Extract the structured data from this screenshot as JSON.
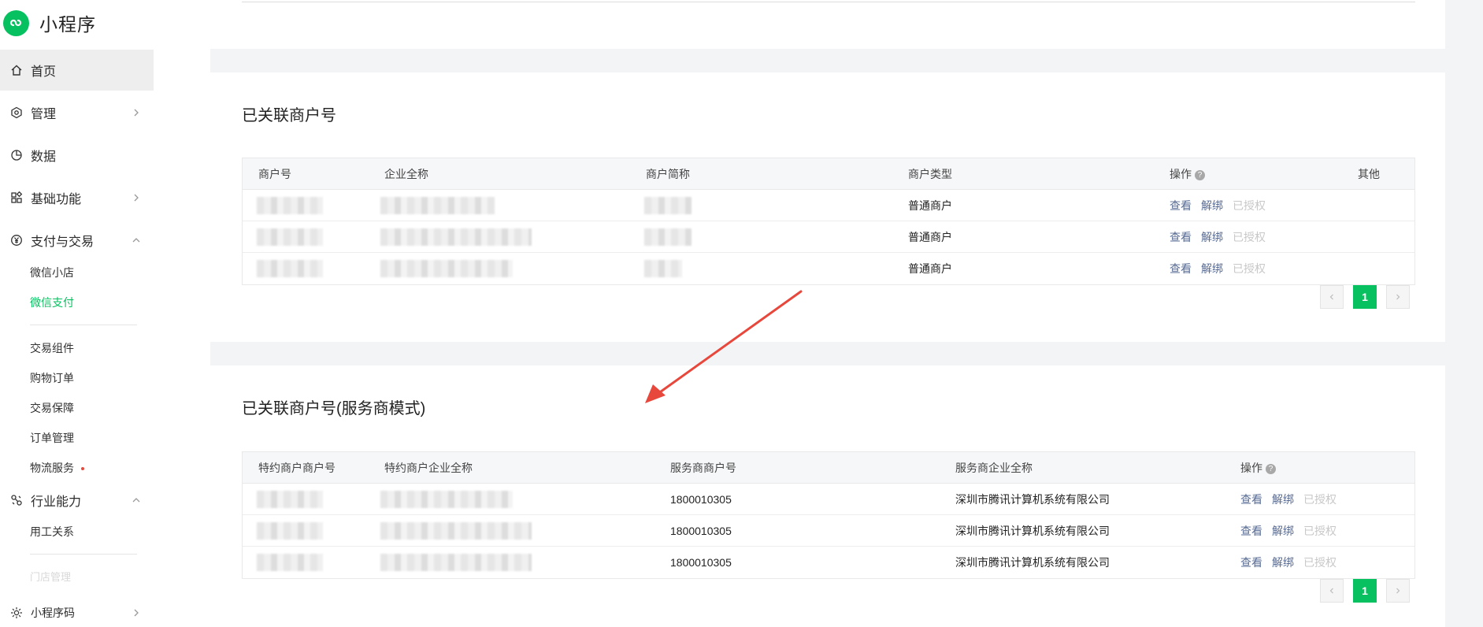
{
  "brand": {
    "name": "小程序",
    "logo_icon": "mini-program-logo-icon",
    "accent": "#07c160"
  },
  "sidebar": {
    "items": [
      {
        "label": "首页",
        "icon": "home-icon",
        "active": true
      },
      {
        "label": "管理",
        "icon": "manage-icon",
        "chevron": "right"
      },
      {
        "label": "数据",
        "icon": "data-pie-icon"
      },
      {
        "label": "基础功能",
        "icon": "grid-icon",
        "chevron": "right"
      },
      {
        "label": "支付与交易",
        "icon": "yen-icon",
        "chevron": "up"
      }
    ],
    "payment_sub": [
      "微信小店",
      "微信支付"
    ],
    "trade_sub": [
      "交易组件",
      "购物订单",
      "交易保障",
      "订单管理",
      "物流服务"
    ],
    "industry": {
      "label": "行业能力",
      "icon": "industry-icon",
      "chevron": "up"
    },
    "industry_sub": [
      "用工关系"
    ],
    "faded_text": "门店管理",
    "bottom": {
      "label": "小程序码",
      "icon": "qrcode-sun-icon",
      "chevron": "right"
    }
  },
  "section1": {
    "title": "已关联商户号",
    "columns": [
      "商户号",
      "企业全称",
      "商户简称",
      "商户类型",
      "操作",
      "其他"
    ],
    "rows": [
      {
        "type": "普通商户"
      },
      {
        "type": "普通商户"
      },
      {
        "type": "普通商户"
      }
    ],
    "actions": {
      "view": "查看",
      "unbind": "解绑",
      "authorized": "已授权"
    },
    "pagination": {
      "current": "1"
    }
  },
  "section2": {
    "title": "已关联商户号(服务商模式)",
    "columns": [
      "特约商户商户号",
      "特约商户企业全称",
      "服务商商户号",
      "服务商企业全称",
      "操作"
    ],
    "rows": [
      {
        "sp_mchid": "1800010305",
        "sp_name": "深圳市腾讯计算机系统有限公司"
      },
      {
        "sp_mchid": "1800010305",
        "sp_name": "深圳市腾讯计算机系统有限公司"
      },
      {
        "sp_mchid": "1800010305",
        "sp_name": "深圳市腾讯计算机系统有限公司"
      }
    ],
    "actions": {
      "view": "查看",
      "unbind": "解绑",
      "authorized": "已授权"
    },
    "pagination": {
      "current": "1"
    }
  },
  "colors": {
    "link": "#576b95",
    "disabled": "#c8c8c8",
    "annotation_arrow": "#e8473c",
    "badge_dot": "#e54a3d"
  }
}
